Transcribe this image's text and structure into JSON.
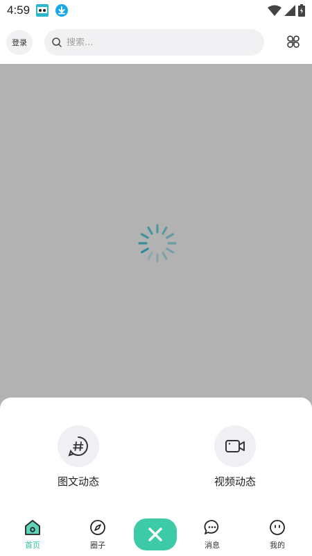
{
  "status_bar": {
    "time": "4:59",
    "icons": [
      "app-notification-icon",
      "download-icon",
      "wifi-icon",
      "signal-icon",
      "battery-icon"
    ]
  },
  "header": {
    "login_label": "登录",
    "search": {
      "placeholder": "搜索...",
      "value": ""
    },
    "menu_icon": "grid-icon"
  },
  "content": {
    "state": "loading",
    "spinner_color": "#2a8c9a"
  },
  "post_sheet": {
    "options": [
      {
        "label": "图文动态",
        "icon": "hashtag-chat-icon"
      },
      {
        "label": "视频动态",
        "icon": "video-camera-icon"
      }
    ]
  },
  "tab_bar": {
    "accent_color": "#30c3a0",
    "tabs": [
      {
        "label": "首页",
        "icon": "home-icon",
        "active": true
      },
      {
        "label": "圈子",
        "icon": "compass-icon",
        "active": false
      },
      {
        "label": "消息",
        "icon": "chat-icon",
        "active": false
      },
      {
        "label": "我的",
        "icon": "face-icon",
        "active": false
      }
    ],
    "center_button_icon": "close-icon"
  }
}
